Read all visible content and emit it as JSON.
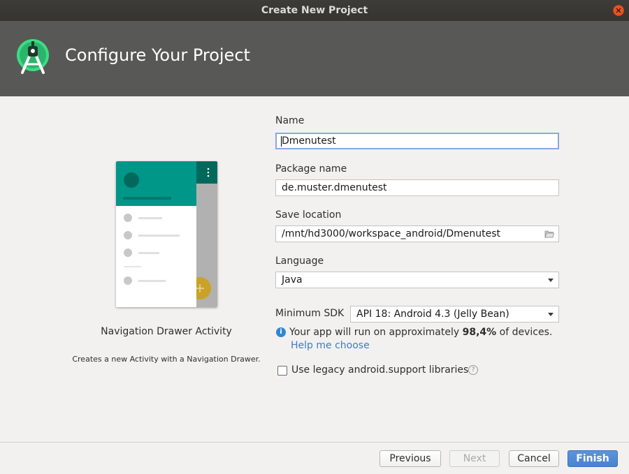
{
  "window": {
    "title": "Create New Project"
  },
  "header": {
    "title": "Configure Your Project"
  },
  "activity": {
    "name": "Navigation Drawer Activity",
    "description": "Creates a new Activity with a Navigation Drawer."
  },
  "form": {
    "name": {
      "label": "Name",
      "value": "Dmenutest"
    },
    "package": {
      "label": "Package name",
      "value": "de.muster.dmenutest"
    },
    "save_location": {
      "label": "Save location",
      "value": "/mnt/hd3000/workspace_android/Dmenutest"
    },
    "language": {
      "label": "Language",
      "value": "Java"
    },
    "min_sdk": {
      "label": "Minimum SDK",
      "value": "API 18: Android 4.3 (Jelly Bean)",
      "info_prefix": "Your app will run on approximately",
      "info_percent": "98,4%",
      "info_suffix": "of devices.",
      "help_link": "Help me choose"
    },
    "legacy": {
      "label": "Use legacy android.support libraries",
      "checked": false,
      "help_glyph": "?"
    }
  },
  "buttons": {
    "previous": "Previous",
    "next": "Next",
    "cancel": "Cancel",
    "finish": "Finish"
  },
  "colors": {
    "accent": "#e95420",
    "header_bg": "#585856",
    "teal": "#009688",
    "fab": "#d4a017",
    "link": "#3d7cc9",
    "primary_button": "#4a83cf"
  },
  "icons": {
    "logo": "android-studio-logo",
    "info": "info-icon",
    "folder": "folder-icon",
    "help": "question-icon",
    "close": "close-icon"
  }
}
